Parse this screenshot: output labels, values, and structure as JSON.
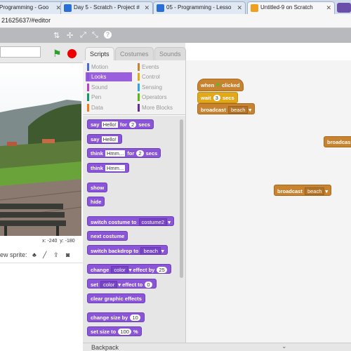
{
  "browser": {
    "tabs": [
      {
        "title": "Programming - Goo",
        "fav_color": "#4a87e8",
        "active": false
      },
      {
        "title": "Day 5 - Scratch - Project #",
        "fav_color": "#2a6fd6",
        "active": false
      },
      {
        "title": "05 - Programming - Lesso",
        "fav_color": "#2a6fd6",
        "active": false
      },
      {
        "title": "Untitled-9 on Scratch",
        "fav_color": "#f0a020",
        "active": true
      }
    ],
    "url": "21625637/#editor"
  },
  "editor": {
    "tools": [
      "⇅",
      "✢",
      "⤢",
      "⤡",
      "?"
    ],
    "stage": {
      "mouse_x": "x: -240",
      "mouse_y": "y: -180",
      "new_sprite_label": "ew sprite:"
    },
    "panel_tabs": [
      "Scripts",
      "Costumes",
      "Sounds"
    ],
    "categories": [
      {
        "label": "Motion",
        "color": "#4a6cd4",
        "active": false
      },
      {
        "label": "Events",
        "color": "#c88330",
        "active": false
      },
      {
        "label": "Looks",
        "color": "#8a55d7",
        "active": true
      },
      {
        "label": "Control",
        "color": "#e1a91a",
        "active": false
      },
      {
        "label": "Sound",
        "color": "#bb42c3",
        "active": false
      },
      {
        "label": "Sensing",
        "color": "#2ca5e2",
        "active": false
      },
      {
        "label": "Pen",
        "color": "#0e9a6c",
        "active": false
      },
      {
        "label": "Operators",
        "color": "#5cb712",
        "active": false
      },
      {
        "label": "Data",
        "color": "#ee7d16",
        "active": false
      },
      {
        "label": "More Blocks",
        "color": "#632d99",
        "active": false
      }
    ],
    "blocks": {
      "say_for": {
        "a": "say",
        "b": "Hello!",
        "c": "for",
        "d": "2",
        "e": "secs"
      },
      "say": {
        "a": "say",
        "b": "Hello!"
      },
      "think_for": {
        "a": "think",
        "b": "Hmm...",
        "c": "for",
        "d": "2",
        "e": "secs"
      },
      "think": {
        "a": "think",
        "b": "Hmm..."
      },
      "show": "show",
      "hide": "hide",
      "switch_costume": {
        "a": "switch costume to",
        "b": "costume2"
      },
      "next_costume": "next costume",
      "switch_backdrop": {
        "a": "switch backdrop to",
        "b": "beach"
      },
      "change_effect": {
        "a": "change",
        "b": "color",
        "c": "effect by",
        "d": "25"
      },
      "set_effect": {
        "a": "set",
        "b": "color",
        "c": "effect to",
        "d": "0"
      },
      "clear_effects": "clear graphic effects",
      "change_size": {
        "a": "change size by",
        "b": "10"
      },
      "set_size": {
        "a": "set size to",
        "b": "100",
        "c": "%"
      }
    },
    "script": {
      "when_clicked": {
        "a": "when",
        "b": "clicked"
      },
      "wait": {
        "a": "wait",
        "b": "3",
        "c": "secs"
      },
      "broadcast1": {
        "a": "broadcast",
        "b": "beach"
      },
      "broadcast2": {
        "a": "broadcast",
        "b": "beach"
      },
      "broadcast3": {
        "a": "broadcas"
      }
    },
    "backpack": "Backpack"
  }
}
